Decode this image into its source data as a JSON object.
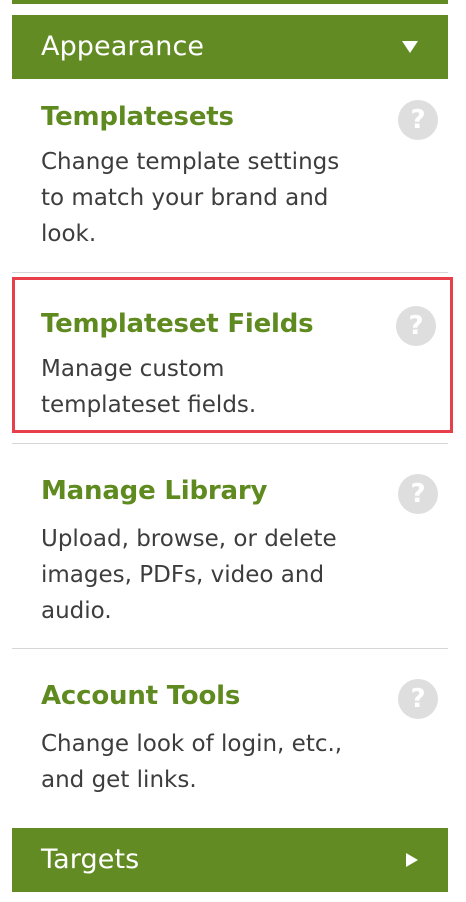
{
  "sections": {
    "appearance": {
      "label": "Appearance",
      "state": "expanded",
      "caret_icon": "caret-down-icon"
    },
    "targets": {
      "label": "Targets",
      "state": "collapsed",
      "caret_icon": "caret-right-icon"
    }
  },
  "items": [
    {
      "title": "Templatesets",
      "description": "Change template settings to match your brand and look.",
      "help": "?"
    },
    {
      "title": "Templateset Fields",
      "description": "Manage custom templateset fields.",
      "help": "?",
      "highlighted": true
    },
    {
      "title": "Manage Library",
      "description": "Upload, browse, or delete images, PDFs, video and audio.",
      "help": "?"
    },
    {
      "title": "Account Tools",
      "description": "Change look of login, etc., and get links.",
      "help": "?"
    }
  ],
  "colors": {
    "header_bg": "#628b24",
    "title_green": "#5e8a1f",
    "highlight_border": "#e8404a",
    "help_icon_bg": "#dedede",
    "text": "#3d3d3d"
  }
}
